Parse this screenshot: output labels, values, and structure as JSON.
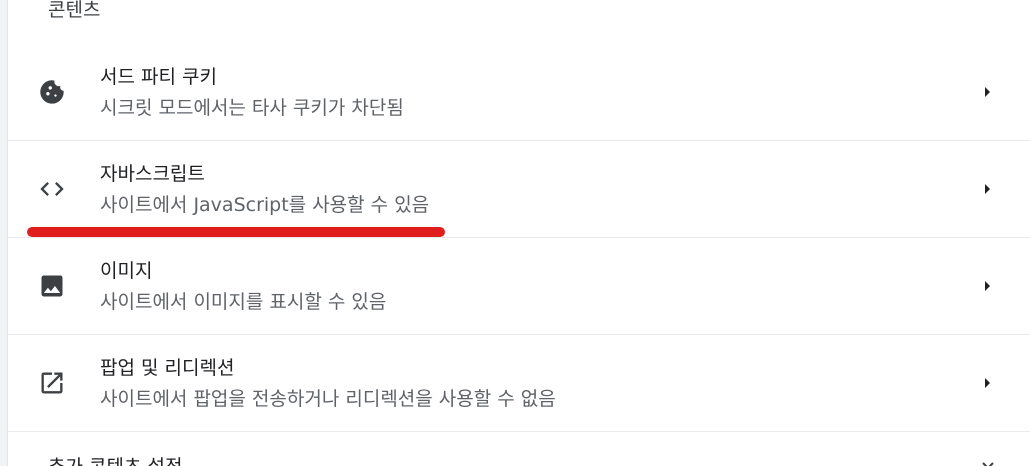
{
  "section": {
    "title": "콘텐츠"
  },
  "rows": [
    {
      "title": "서드 파티 쿠키",
      "subtitle": "시크릿 모드에서는 타사 쿠키가 차단됨",
      "icon": "cookie-icon"
    },
    {
      "title": "자바스크립트",
      "subtitle": "사이트에서 JavaScript를 사용할 수 있음",
      "icon": "code-icon"
    },
    {
      "title": "이미지",
      "subtitle": "사이트에서 이미지를 표시할 수 있음",
      "icon": "image-icon"
    },
    {
      "title": "팝업 및 리디렉션",
      "subtitle": "사이트에서 팝업을 전송하거나 리디렉션을 사용할 수 없음",
      "icon": "open-in-new-icon"
    }
  ],
  "more_settings": {
    "label": "추가 콘텐츠 설정",
    "icon": "chevron-down-icon"
  },
  "colors": {
    "highlight": "#e01e1e",
    "icon": "#3c4043",
    "divider": "#e8eaed"
  }
}
